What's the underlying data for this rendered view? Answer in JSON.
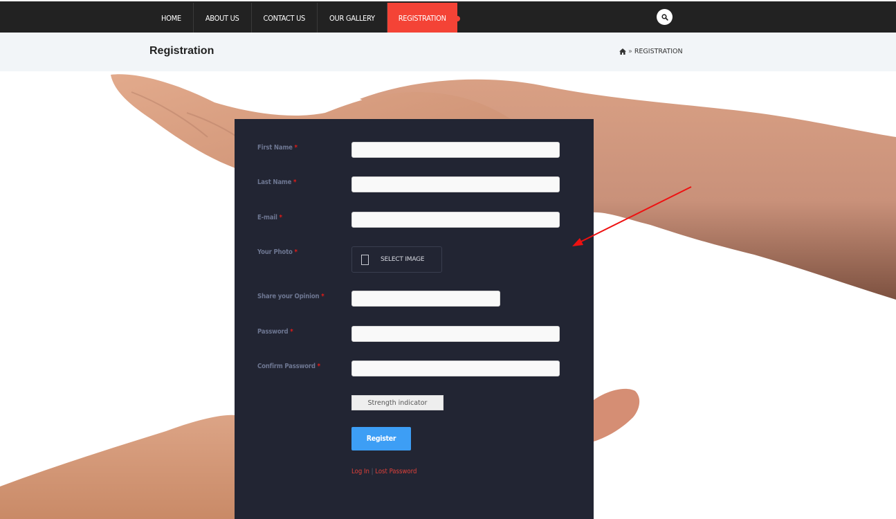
{
  "nav": {
    "items": [
      {
        "label": "HOME",
        "active": false
      },
      {
        "label": "ABOUT US",
        "active": false
      },
      {
        "label": "CONTACT US",
        "active": false
      },
      {
        "label": "OUR GALLERY",
        "active": false
      },
      {
        "label": "REGISTRATION",
        "active": true
      }
    ],
    "search_icon": "search-icon"
  },
  "header": {
    "title": "Registration",
    "breadcrumb": {
      "home_icon": "home-icon",
      "separator": "»",
      "current": "REGISTRATION"
    }
  },
  "form": {
    "required_marker": "*",
    "fields": [
      {
        "label": "First Name",
        "type": "text",
        "value": "",
        "required": true
      },
      {
        "label": "Last Name",
        "type": "text",
        "value": "",
        "required": true
      },
      {
        "label": "E-mail",
        "type": "email",
        "value": "",
        "required": true
      },
      {
        "label": "Your Photo",
        "type": "file",
        "button_label": "SELECT IMAGE",
        "required": true
      },
      {
        "label": "Share your Opinion",
        "type": "text",
        "value": "",
        "required": true
      },
      {
        "label": "Password",
        "type": "password",
        "value": "",
        "required": true
      },
      {
        "label": "Confirm Password",
        "type": "password",
        "value": "",
        "required": true
      }
    ],
    "strength_indicator": "Strength indicator",
    "submit_label": "Register",
    "links": {
      "login": "Log In",
      "separator": "|",
      "lost_password": "Lost Password"
    }
  },
  "colors": {
    "nav_bg": "#222222",
    "nav_active": "#f44336",
    "panel_bg": "#222533",
    "label": "#6d7691",
    "required": "#e41b17",
    "register_button": "#3d9ef5",
    "link": "#e0413a",
    "annotation_arrow": "#ee1111"
  }
}
